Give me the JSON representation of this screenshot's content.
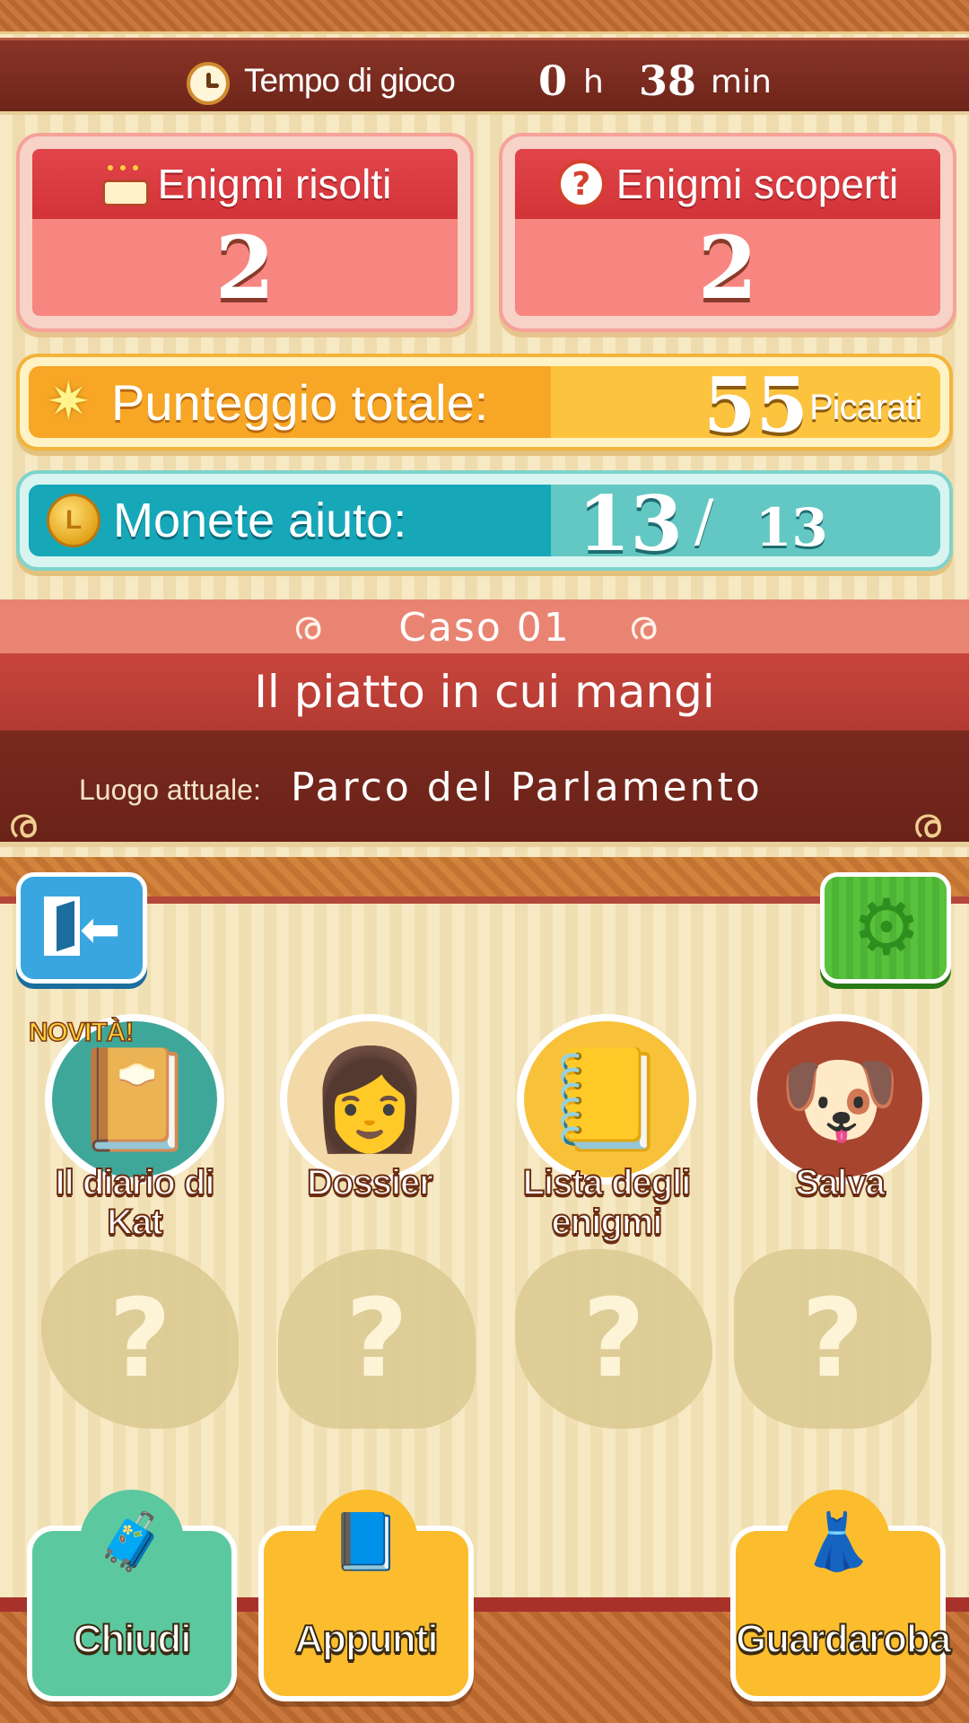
{
  "playtime": {
    "label": "Tempo di gioco",
    "hours": "0",
    "hours_unit": "h",
    "minutes": "38",
    "minutes_unit": "min"
  },
  "stats": {
    "solved_label": "Enigmi risolti",
    "solved_value": "2",
    "discovered_label": "Enigmi scoperti",
    "discovered_value": "2"
  },
  "score": {
    "label": "Punteggio totale:",
    "value": "55",
    "unit": "Picarati"
  },
  "hint_coins": {
    "label": "Monete aiuto:",
    "value": "13",
    "separator": "/",
    "max": "13"
  },
  "case": {
    "number": "Caso 01",
    "title": "Il piatto in cui mangi",
    "location_label": "Luogo attuale:",
    "location_value": "Parco del Parlamento"
  },
  "menu": {
    "new_badge": "NOVITÀ!",
    "items": [
      {
        "label": "Il diario di Kat",
        "icon": "diary-icon"
      },
      {
        "label": "Dossier",
        "icon": "katrielle-icon"
      },
      {
        "label": "Lista degli enigmi",
        "icon": "puzzle-list-icon"
      },
      {
        "label": "Salva",
        "icon": "sleeping-dog-icon"
      }
    ],
    "locked": [
      "?",
      "?",
      "?",
      "?"
    ]
  },
  "bottom": {
    "close_label": "Chiudi",
    "notes_label": "Appunti",
    "wardrobe_label": "Guardaroba"
  },
  "colors": {
    "banner_red": "#b23a32",
    "score_orange": "#f7a725",
    "coins_teal": "#16a7b9",
    "stat_red": "#d23338"
  }
}
